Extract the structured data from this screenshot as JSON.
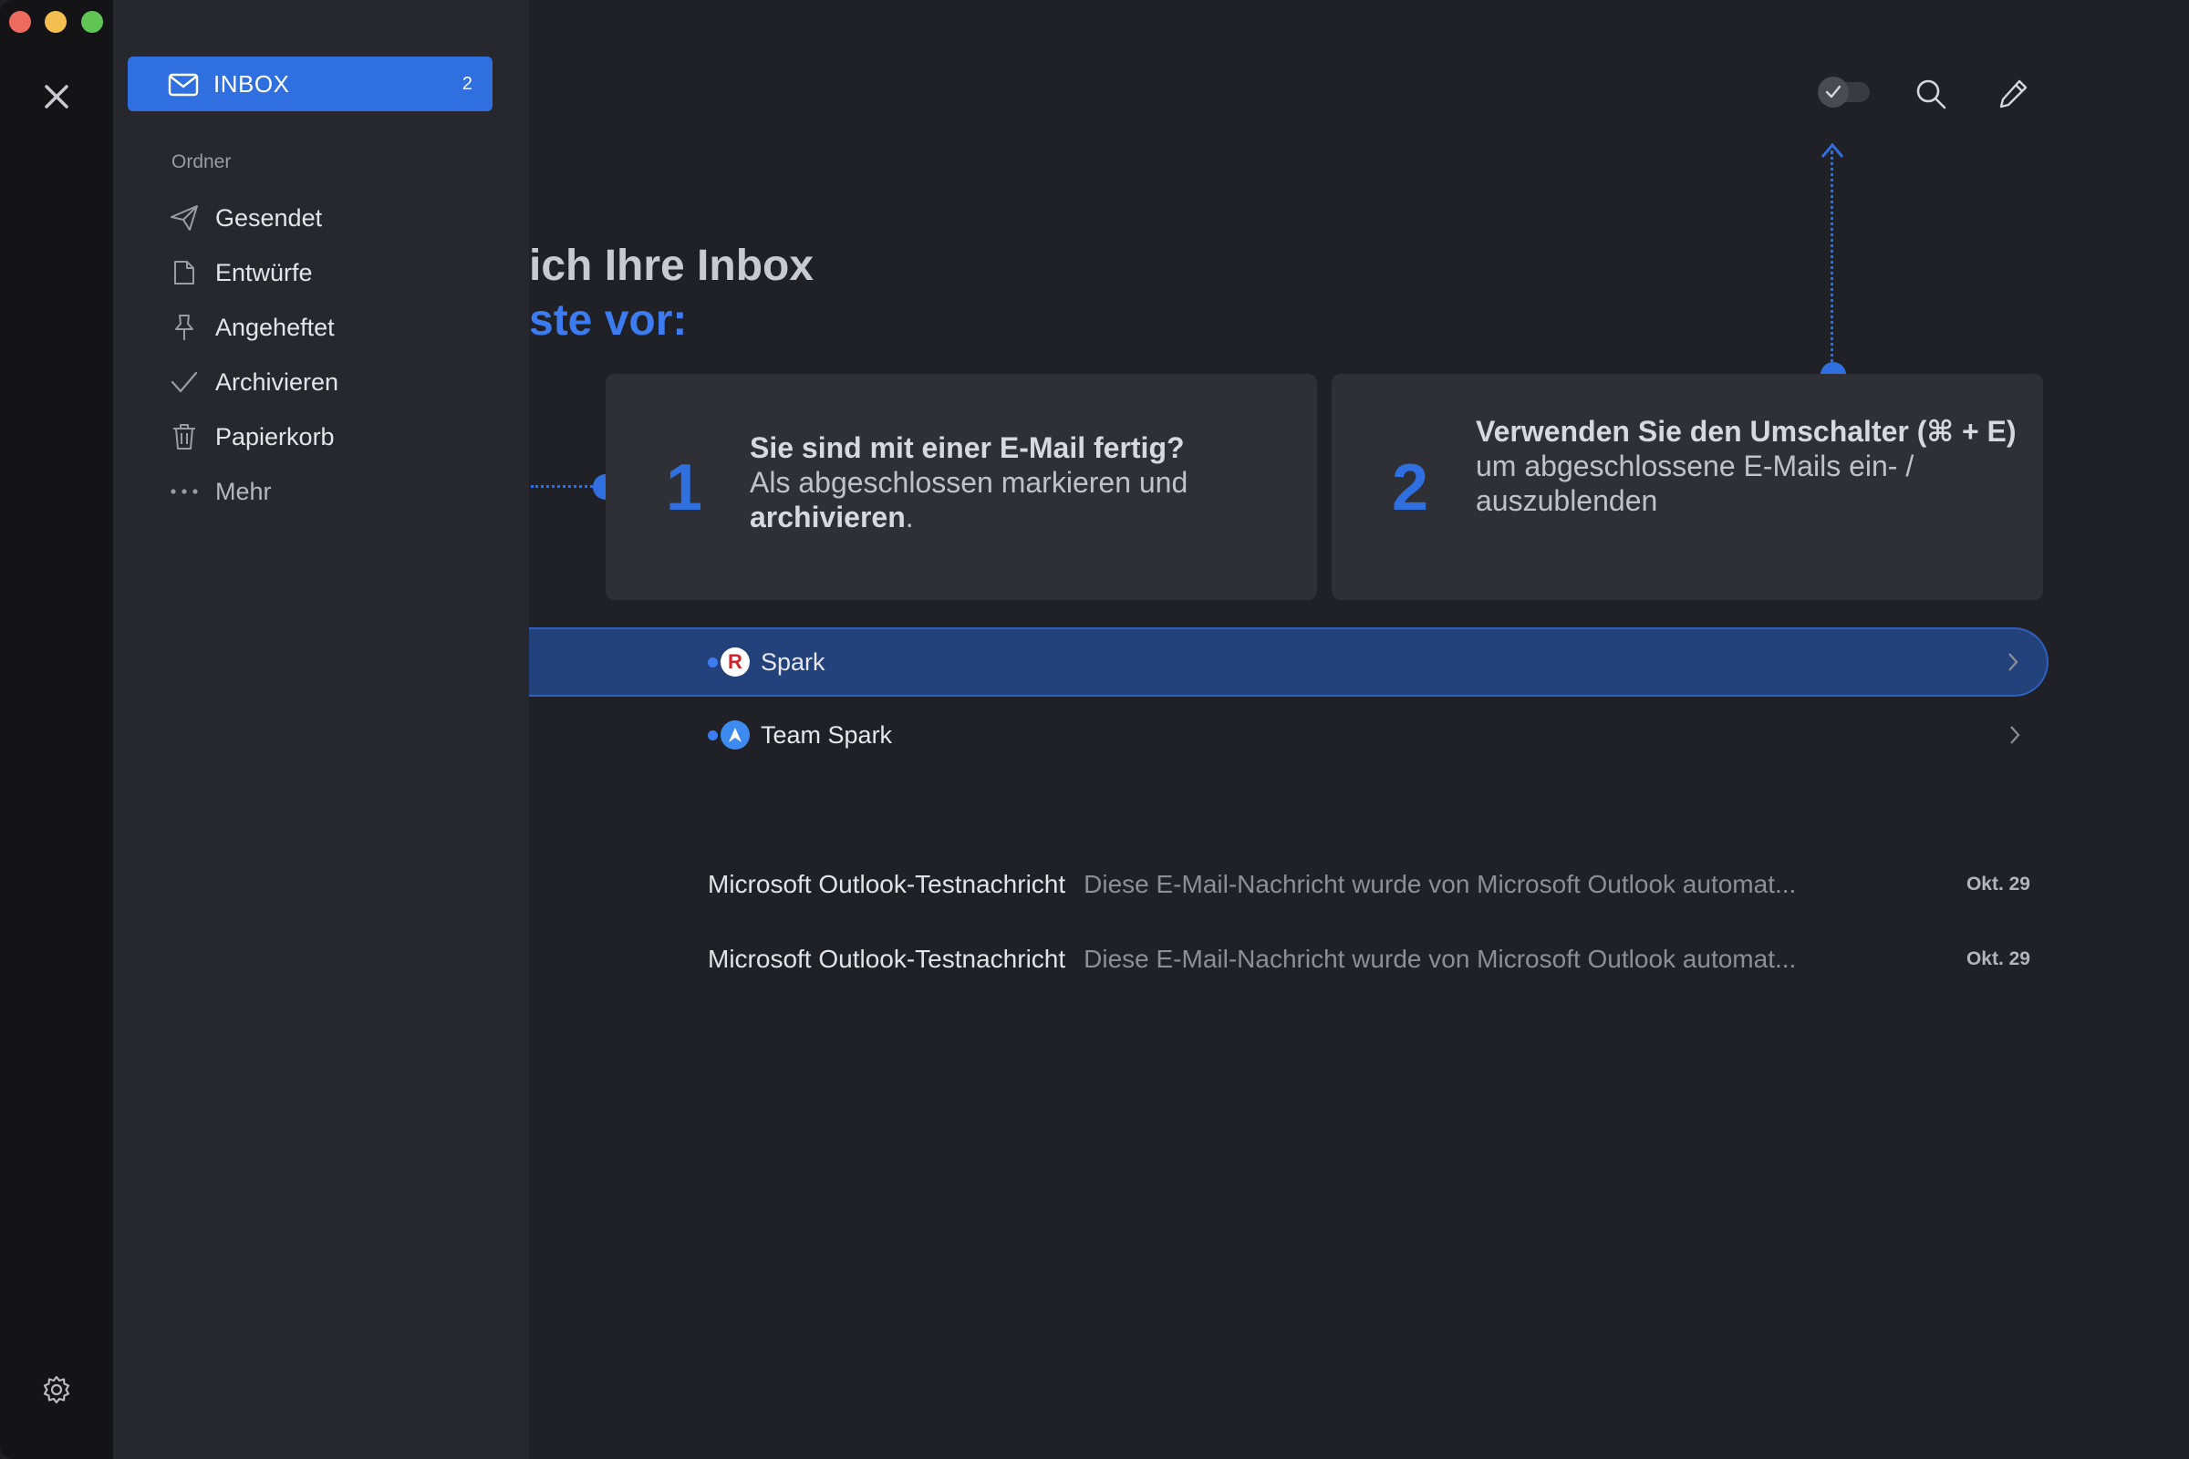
{
  "sidebar": {
    "inbox": {
      "label": "INBOX",
      "count": "2"
    },
    "section_label": "Ordner",
    "folders": [
      {
        "label": "Gesendet",
        "icon": "paper-plane-icon"
      },
      {
        "label": "Entwürfe",
        "icon": "document-icon"
      },
      {
        "label": "Angeheftet",
        "icon": "pin-icon"
      },
      {
        "label": "Archivieren",
        "icon": "checkmark-icon"
      },
      {
        "label": "Papierkorb",
        "icon": "trash-icon"
      },
      {
        "label": "Mehr",
        "icon": "ellipsis-icon"
      }
    ]
  },
  "headline": {
    "line1": "ich Ihre Inbox",
    "line2": "ste vor:"
  },
  "cards": [
    {
      "number": "1",
      "title": "Sie sind mit einer E-Mail fertig?",
      "text_before": "Als abgeschlossen markieren und",
      "text_strong": "archivieren",
      "text_after": "."
    },
    {
      "number": "2",
      "title": "Verwenden Sie den Umschalter (⌘ + E)",
      "text": "um abgeschlossene E-Mails ein- / auszublenden"
    }
  ],
  "threads": [
    {
      "sender": "Spark",
      "avatar_letter": "R"
    },
    {
      "sender": "Team Spark"
    }
  ],
  "mails": [
    {
      "subject": "Microsoft Outlook-Testnachricht",
      "preview": "Diese E-Mail-Nachricht wurde von Microsoft Outlook automat...",
      "date": "Okt. 29"
    },
    {
      "subject": "Microsoft Outlook-Testnachricht",
      "preview": "Diese E-Mail-Nachricht wurde von Microsoft Outlook automat...",
      "date": "Okt. 29"
    }
  ],
  "colors": {
    "accent": "#2f6fe0",
    "background": "#202126",
    "sidebar": "#27282d",
    "active_row": "#23417a"
  }
}
